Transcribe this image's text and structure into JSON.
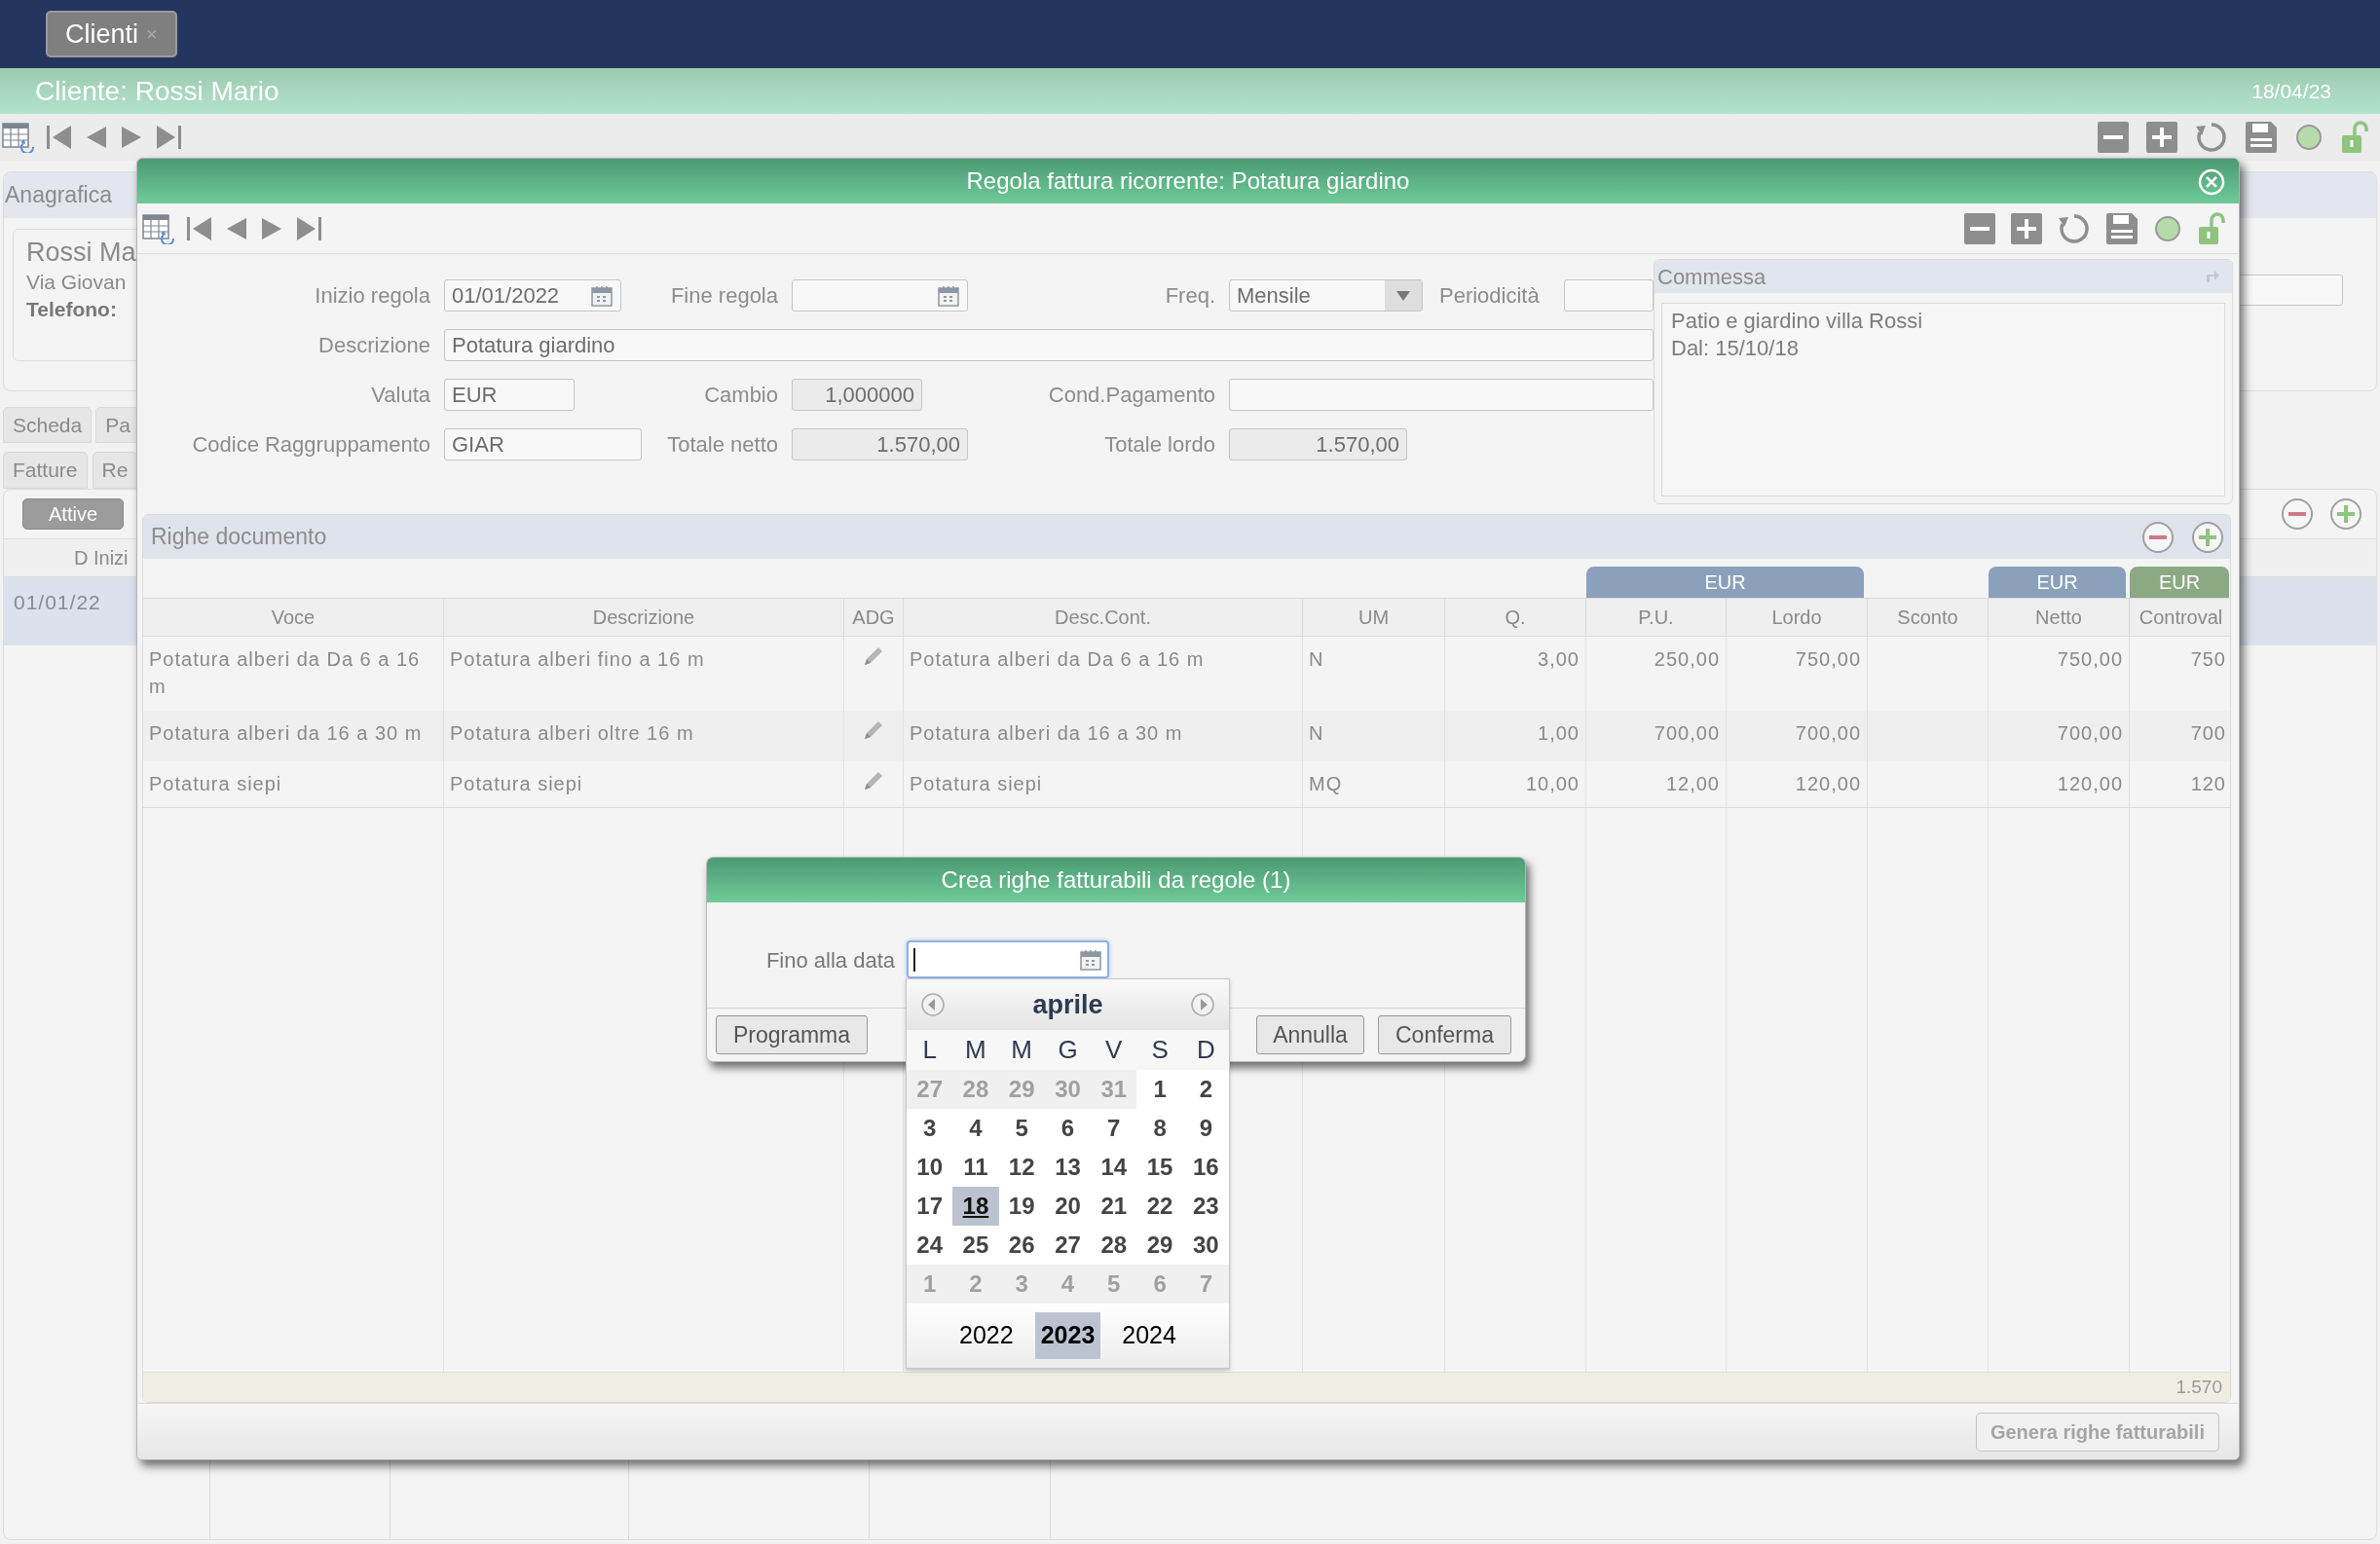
{
  "top_tab": {
    "label": "Clienti",
    "close": "×"
  },
  "header": {
    "title": "Cliente: Rossi Mario",
    "date": "18/04/23"
  },
  "background": {
    "anagrafica": {
      "title": "Anagrafica",
      "name": "Rossi Ma",
      "address": "Via Giovan",
      "phone_label": "Telefono:"
    },
    "tabs_top": [
      {
        "label": "Scheda"
      },
      {
        "label": "Pa"
      }
    ],
    "tabs_bottom": [
      {
        "label": "Fatture"
      },
      {
        "label": "Re"
      }
    ],
    "filters": [
      {
        "label": "Attive",
        "selected": true
      }
    ],
    "column": "D Inizi",
    "rows": [
      {
        "date": "01/01/22",
        "selected": true
      }
    ]
  },
  "modal": {
    "title": "Regola fattura ricorrente: Potatura giardino",
    "form": {
      "inizio_regola": {
        "label": "Inizio regola",
        "value": "01/01/2022",
        "kind": "date",
        "readonly": false
      },
      "fine_regola": {
        "label": "Fine regola",
        "kind": "date",
        "readonly": false
      },
      "freq": {
        "label": "Freq.",
        "value": "Mensile",
        "kind": "select",
        "readonly": false
      },
      "periodicita": {
        "label": "Periodicità",
        "kind": "text",
        "readonly": false
      },
      "descrizione": {
        "label": "Descrizione",
        "value": "Potatura giardino",
        "kind": "text",
        "readonly": false
      },
      "valuta": {
        "label": "Valuta",
        "value": "EUR",
        "kind": "text",
        "readonly": false
      },
      "cambio": {
        "label": "Cambio",
        "value": "1,000000",
        "kind": "number",
        "readonly": true
      },
      "cond_pagamento": {
        "label": "Cond.Pagamento",
        "kind": "text",
        "readonly": false
      },
      "codice_raggruppamento": {
        "label": "Codice Raggruppamento",
        "value": "GIAR",
        "kind": "text",
        "readonly": false
      },
      "totale_netto": {
        "label": "Totale netto",
        "value": "1.570,00",
        "kind": "number",
        "readonly": true
      },
      "totale_lordo": {
        "label": "Totale lordo",
        "value": "1.570,00",
        "kind": "number",
        "readonly": true
      }
    },
    "commessa": {
      "title": "Commessa",
      "lines": [
        "Patio e giardino villa Rossi",
        "Dal: 15/10/18"
      ]
    },
    "righe": {
      "title": "Righe documento",
      "currency_groups": [
        {
          "label": "EUR",
          "color": "#8aa0bb"
        },
        {
          "label": "EUR",
          "color": "#8aa0bb"
        },
        {
          "label": "EUR",
          "color": "#8ba983"
        }
      ],
      "columns": [
        {
          "label": "Voce",
          "kind": "text"
        },
        {
          "label": "Descrizione",
          "kind": "text"
        },
        {
          "label": "ADG",
          "kind": "edit"
        },
        {
          "label": "Desc.Cont.",
          "kind": "text"
        },
        {
          "label": "UM",
          "kind": "text"
        },
        {
          "label": "Q.",
          "kind": "number"
        },
        {
          "label": "P.U.",
          "kind": "number"
        },
        {
          "label": "Lordo",
          "kind": "number"
        },
        {
          "label": "Sconto",
          "kind": "number"
        },
        {
          "label": "Netto",
          "kind": "number"
        },
        {
          "label": "Controval",
          "kind": "number"
        }
      ],
      "rows": [
        {
          "cells": [
            "Potatura alberi da Da 6 a 16 m",
            "Potatura alberi fino a 16 m",
            null,
            "Potatura alberi da Da 6 a 16 m",
            "N",
            "3,00",
            "250,00",
            "750,00",
            null,
            "750,00",
            "750"
          ]
        },
        {
          "cells": [
            "Potatura alberi da 16 a 30 m",
            "Potatura alberi oltre 16 m",
            null,
            "Potatura alberi da 16 a 30 m",
            "N",
            "1,00",
            "700,00",
            "700,00",
            null,
            "700,00",
            "700"
          ]
        },
        {
          "cells": [
            "Potatura siepi",
            "Potatura siepi",
            null,
            "Potatura siepi",
            "MQ",
            "10,00",
            "12,00",
            "120,00",
            null,
            "120,00",
            "120"
          ]
        }
      ],
      "total": "1.570"
    },
    "generate_button": {
      "label": "Genera righe fatturabili",
      "disabled": true
    }
  },
  "dialog": {
    "title": "Crea righe fatturabili da regole (1)",
    "field_label": "Fino alla data",
    "focused": true,
    "buttons": [
      {
        "label": "Programma"
      },
      {
        "label": "Annulla"
      },
      {
        "label": "Conferma"
      }
    ]
  },
  "calendar": {
    "month": "aprile",
    "weekdays": [
      "L",
      "M",
      "M",
      "G",
      "V",
      "S",
      "D"
    ],
    "weeks": [
      [
        {
          "day": "27",
          "muted": true,
          "selected": false
        },
        {
          "day": "28",
          "muted": true,
          "selected": false
        },
        {
          "day": "29",
          "muted": true,
          "selected": false
        },
        {
          "day": "30",
          "muted": true,
          "selected": false
        },
        {
          "day": "31",
          "muted": true,
          "selected": false
        },
        {
          "day": "1",
          "muted": false,
          "selected": false
        },
        {
          "day": "2",
          "muted": false,
          "selected": false
        }
      ],
      [
        {
          "day": "3",
          "muted": false,
          "selected": false
        },
        {
          "day": "4",
          "muted": false,
          "selected": false
        },
        {
          "day": "5",
          "muted": false,
          "selected": false
        },
        {
          "day": "6",
          "muted": false,
          "selected": false
        },
        {
          "day": "7",
          "muted": false,
          "selected": false
        },
        {
          "day": "8",
          "muted": false,
          "selected": false
        },
        {
          "day": "9",
          "muted": false,
          "selected": false
        }
      ],
      [
        {
          "day": "10",
          "muted": false,
          "selected": false
        },
        {
          "day": "11",
          "muted": false,
          "selected": false
        },
        {
          "day": "12",
          "muted": false,
          "selected": false
        },
        {
          "day": "13",
          "muted": false,
          "selected": false
        },
        {
          "day": "14",
          "muted": false,
          "selected": false
        },
        {
          "day": "15",
          "muted": false,
          "selected": false
        },
        {
          "day": "16",
          "muted": false,
          "selected": false
        }
      ],
      [
        {
          "day": "17",
          "muted": false,
          "selected": false
        },
        {
          "day": "18",
          "muted": false,
          "selected": true
        },
        {
          "day": "19",
          "muted": false,
          "selected": false
        },
        {
          "day": "20",
          "muted": false,
          "selected": false
        },
        {
          "day": "21",
          "muted": false,
          "selected": false
        },
        {
          "day": "22",
          "muted": false,
          "selected": false
        },
        {
          "day": "23",
          "muted": false,
          "selected": false
        }
      ],
      [
        {
          "day": "24",
          "muted": false,
          "selected": false
        },
        {
          "day": "25",
          "muted": false,
          "selected": false
        },
        {
          "day": "26",
          "muted": false,
          "selected": false
        },
        {
          "day": "27",
          "muted": false,
          "selected": false
        },
        {
          "day": "28",
          "muted": false,
          "selected": false
        },
        {
          "day": "29",
          "muted": false,
          "selected": false
        },
        {
          "day": "30",
          "muted": false,
          "selected": false
        }
      ],
      [
        {
          "day": "1",
          "muted": true,
          "selected": false
        },
        {
          "day": "2",
          "muted": true,
          "selected": false
        },
        {
          "day": "3",
          "muted": true,
          "selected": false
        },
        {
          "day": "4",
          "muted": true,
          "selected": false
        },
        {
          "day": "5",
          "muted": true,
          "selected": false
        },
        {
          "day": "6",
          "muted": true,
          "selected": false
        },
        {
          "day": "7",
          "muted": true,
          "selected": false
        }
      ]
    ],
    "years": [
      {
        "label": "2022",
        "selected": false
      },
      {
        "label": "2023",
        "selected": true
      },
      {
        "label": "2024",
        "selected": false
      }
    ]
  }
}
